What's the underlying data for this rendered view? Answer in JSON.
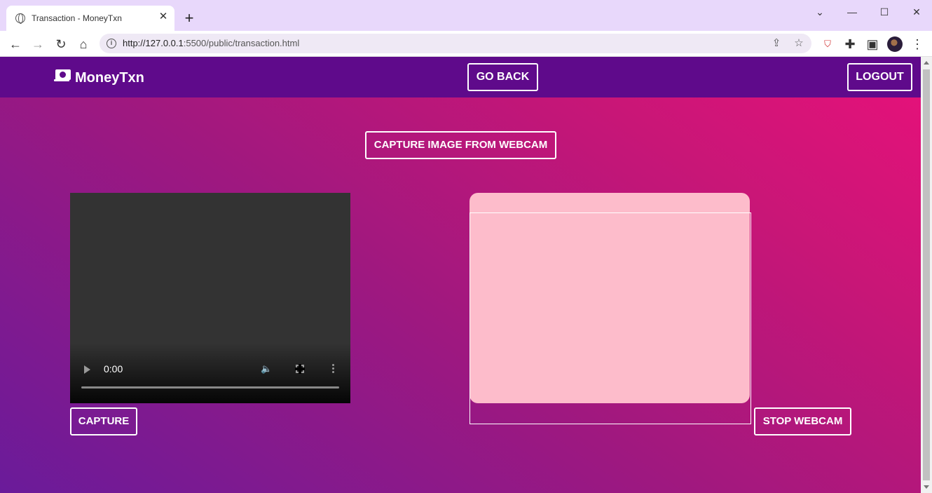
{
  "browser": {
    "tab_title": "Transaction - MoneyTxn",
    "url_host": "http://127.0.0.1",
    "url_rest": ":5500/public/transaction.html"
  },
  "navbar": {
    "brand": "MoneyTxn",
    "go_back": "GO BACK",
    "logout": "LOGOUT"
  },
  "page": {
    "capture_webcam": "CAPTURE IMAGE FROM WEBCAM",
    "capture": "CAPTURE",
    "stop_webcam": "STOP WEBCAM"
  },
  "video": {
    "time": "0:00",
    "progress": 0
  },
  "colors": {
    "navbar": "#5f0a8b",
    "canvas": "#fdbccb",
    "tabstrip": "#e8d8fb"
  }
}
